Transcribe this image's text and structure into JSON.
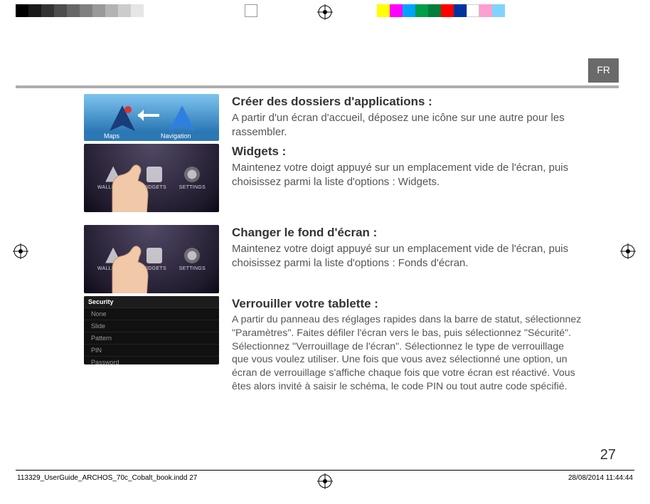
{
  "calibration_colors_left": [
    "#000000",
    "#1a1a1a",
    "#333333",
    "#4d4d4d",
    "#666666",
    "#808080",
    "#999999",
    "#b3b3b3",
    "#cccccc",
    "#e6e6e6",
    "#ffffff"
  ],
  "calibration_colors_right": [
    "#ffff00",
    "#ff00ff",
    "#00a2ff",
    "#009e49",
    "#007e3a",
    "#ff0000",
    "#0033a0",
    "#ffffff",
    "#ff9ecf",
    "#7fd4ff"
  ],
  "lang_tab": "FR",
  "sections": {
    "r1": {
      "title": "Créer des dossiers d'applications :",
      "body": "A partir d'un écran d'accueil, déposez une icône sur une autre pour les rassembler.",
      "thumb": {
        "icon1_label": "Maps",
        "icon2_label": "Navigation"
      }
    },
    "r2": {
      "title": "Widgets :",
      "body": "Maintenez votre doigt appuyé sur un emplacement vide de l'écran, puis choisissez parmi la liste d'options : Widgets.",
      "thumb_labels": [
        "WALLPAPER",
        "WIDGETS",
        "SETTINGS"
      ]
    },
    "r3": {
      "title": "Changer le fond d'écran :",
      "body": "Maintenez votre doigt appuyé sur un emplacement vide de l'écran, puis choisissez parmi la liste d'options : Fonds d'écran.",
      "thumb_labels": [
        "WALLPAPER",
        "WIDGETS",
        "SETTINGS"
      ]
    },
    "r4": {
      "title": "Verrouiller votre tablette :",
      "body": "A partir du panneau des réglages rapides dans la barre de statut, sélectionnez \"Paramètres\".  Faites défiler l'écran vers le bas, puis sélectionnez \"Sécurité\". Sélectionnez \"Verrouillage de l'écran\". Sélectionnez le type de verrouillage que vous voulez utiliser. Une fois que vous avez sélectionné une option, un écran de verrouillage s'affiche chaque fois que votre écran est réactivé. Vous êtes alors invité à saisir le schéma, le code PIN ou tout autre code spécifié.",
      "thumb_list": {
        "header": "Security",
        "items": [
          "None",
          "Slide",
          "Pattern",
          "PIN",
          "Password"
        ]
      }
    }
  },
  "page_number": "27",
  "footer": {
    "left": "113329_UserGuide_ARCHOS_70c_Cobalt_book.indd   27",
    "right": "28/08/2014   11:44:44"
  }
}
